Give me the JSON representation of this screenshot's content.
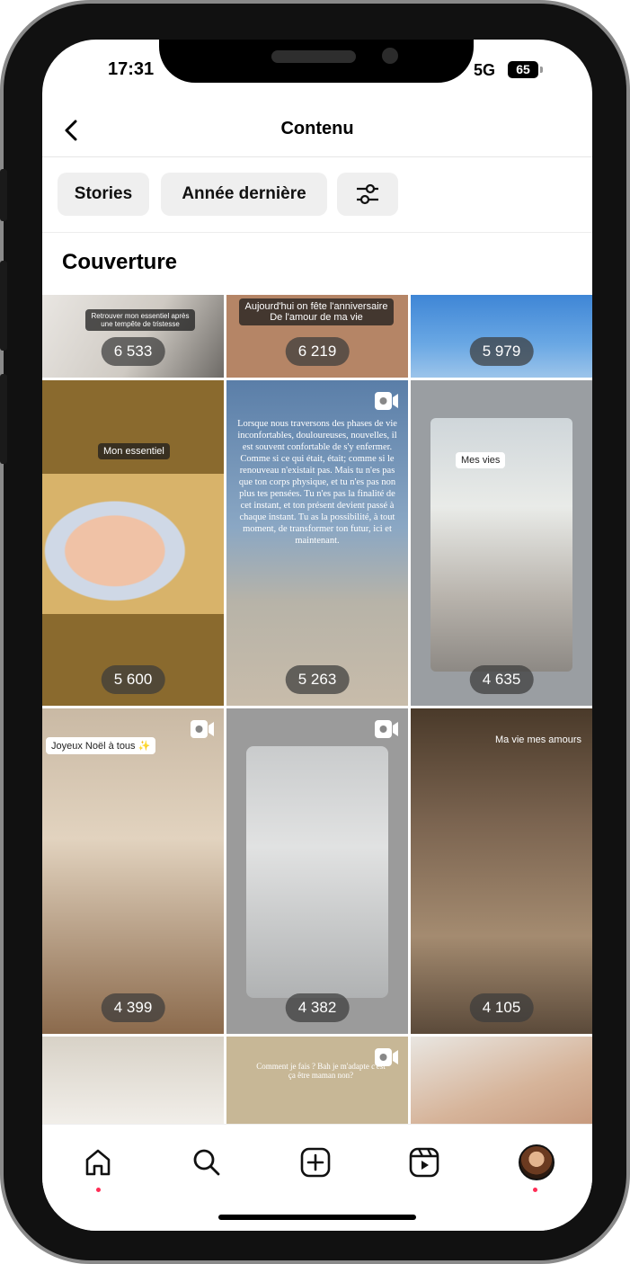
{
  "status_bar": {
    "time": "17:31",
    "network": "5G",
    "battery": "65"
  },
  "header": {
    "title": "Contenu"
  },
  "filters": {
    "stories_label": "Stories",
    "period_label": "Année dernière"
  },
  "section": {
    "title": "Couverture"
  },
  "grid": {
    "tiles": [
      {
        "count": "6 533",
        "tag": "Retrouver mon essentiel après une tempête de tristesse"
      },
      {
        "count": "6 219",
        "tag": "Aujourd'hui on fête l'anniversaire\nDe l'amour de ma vie"
      },
      {
        "count": "5 979"
      },
      {
        "count": "5 600",
        "tag": "Mon essentiel"
      },
      {
        "count": "5 263",
        "tag": "Lorsque nous traversons des phases de vie inconfortables, douloureuses, nouvelles, il est souvent confortable de s'y enfermer. Comme si ce qui était, était; comme si le renouveau n'existait pas. Mais tu n'es pas que ton corps physique, et tu n'es pas non plus tes pensées. Tu n'es pas la finalité de cet instant, et ton présent devient passé à chaque instant. Tu as la possibilité, à tout moment, de transformer ton futur, ici et maintenant."
      },
      {
        "count": "4 635",
        "tag": "Mes vies"
      },
      {
        "count": "4 399",
        "tag": "Joyeux Noël à tous ✨"
      },
      {
        "count": "4 382"
      },
      {
        "count": "4 105",
        "tag": "Ma vie mes amours"
      },
      {
        "count": ""
      },
      {
        "count": "",
        "tag": "Comment je fais ? Bah je m'adapte c'est ça être maman non?"
      },
      {
        "count": ""
      }
    ]
  },
  "colors": {
    "accent_dot": "#ff2d55",
    "chip_bg": "#efefef"
  },
  "tabbar": {
    "items": [
      "home-icon",
      "search-icon",
      "create-icon",
      "reels-icon",
      "profile-avatar"
    ]
  }
}
